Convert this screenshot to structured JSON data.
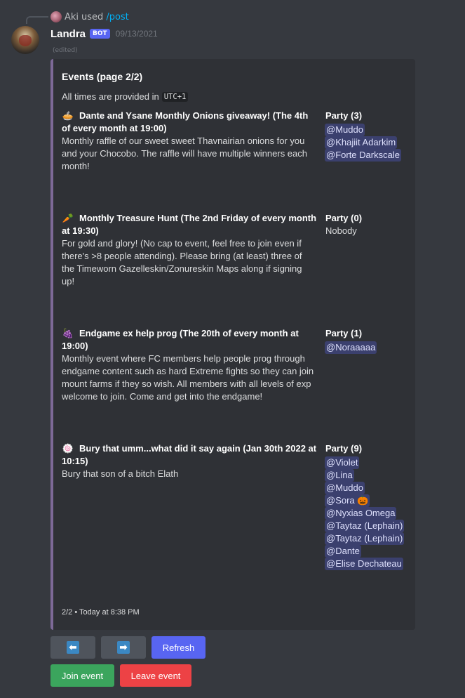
{
  "reply": {
    "user": "Aki",
    "used": "used",
    "command": "/post"
  },
  "message": {
    "author": "Landra",
    "bot_tag": "BOT",
    "timestamp": "09/13/2021",
    "edited": "(edited)"
  },
  "embed": {
    "accent_color": "#7d6997",
    "title": "Events (page 2/2)",
    "description": "All times are provided in",
    "timezone": "UTC+1",
    "events": [
      {
        "emoji": "🥧",
        "title": "Dante and Ysane Monthly Onions giveaway! (The 4th of every month at 19:00)",
        "description": "Monthly raffle of our sweet sweet Thavnairian onions for you and your Chocobo. The raffle will have multiple winners each month!",
        "party_title": "Party (3)",
        "party": [
          "@Muddo",
          "@Khajiit Adarkim",
          "@Forte Darkscale"
        ]
      },
      {
        "emoji": "🥕",
        "title": "Monthly Treasure Hunt (The 2nd Friday of every month at 19:30)",
        "description": "For gold and glory! (No cap to event, feel free to join even if there's >8 people attending). Please bring (at least) three of the Timeworn Gazelleskin/Zonureskin Maps along if signing up!",
        "party_title": "Party (0)",
        "party_empty": "Nobody",
        "party": []
      },
      {
        "emoji": "🍇",
        "title": "Endgame ex help prog (The 20th of every month at 19:00)",
        "description": "Monthly event where FC members help people prog through endgame content such as hard Extreme fights so they can join mount farms if they so wish. All members with all levels of exp welcome to join. Come and get into the endgame!",
        "party_title": "Party (1)",
        "party": [
          "@Noraaaaa"
        ]
      },
      {
        "emoji": "🍥",
        "title": "Bury that umm...what did it say again (Jan 30th 2022 at 10:15)",
        "description": "Bury that son of a bitch Elath",
        "party_title": "Party (9)",
        "party": [
          "@Violet",
          "@Lina",
          "@Muddo",
          "@Sora 🎃",
          "@Nyxias Omega",
          "@Taytaz (Lephain)",
          "@Taytaz (Lephain)",
          "@Dante",
          "@Elise Dechateau"
        ]
      }
    ],
    "footer": "2/2 • Today at 8:38 PM"
  },
  "buttons": {
    "prev_icon": "⬅",
    "next_icon": "➡",
    "refresh": "Refresh",
    "join": "Join event",
    "leave": "Leave event"
  }
}
